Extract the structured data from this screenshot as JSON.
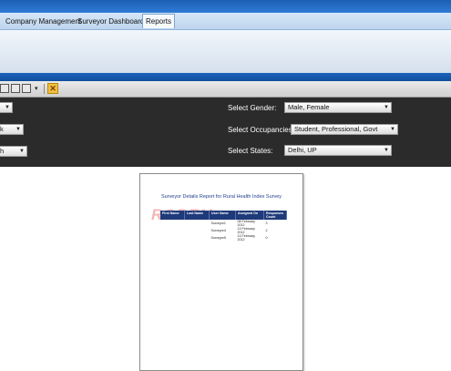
{
  "tabs": [
    {
      "label": "Company Management",
      "active": false
    },
    {
      "label": "Surveyor Dashboard",
      "active": false
    },
    {
      "label": "Reports",
      "active": true
    }
  ],
  "params": {
    "gender_label": "Select Gender:",
    "gender_value": "Male, Female",
    "occupancies_label": "Select Occupancies:",
    "occupancies_value": "Student, Professional, Govt",
    "states_label": "Select States:",
    "states_value": "Delhi, UP",
    "left_select_1": "",
    "left_select_2": "k",
    "left_select_3": "h"
  },
  "report": {
    "title": "Surveyor Details Report for Rural Health Index Survey",
    "watermark": "ROBEM",
    "columns": [
      "First Name",
      "Last Name",
      "User Name",
      "Assigned On",
      "Responses Count"
    ],
    "rows": [
      [
        "",
        "",
        "Surveyor1",
        "08 February 2012",
        "3"
      ],
      [
        "",
        "",
        "Surveyor4",
        "13 February 2012",
        "2"
      ],
      [
        "",
        "",
        "Surveyor5",
        "13 February 2012",
        "0"
      ]
    ]
  },
  "colors": {
    "ribbon_blue": "#1d63bb",
    "params_bg": "#2b2b2b",
    "table_header": "#1f3a7a",
    "title_text": "#1f3f8f"
  }
}
